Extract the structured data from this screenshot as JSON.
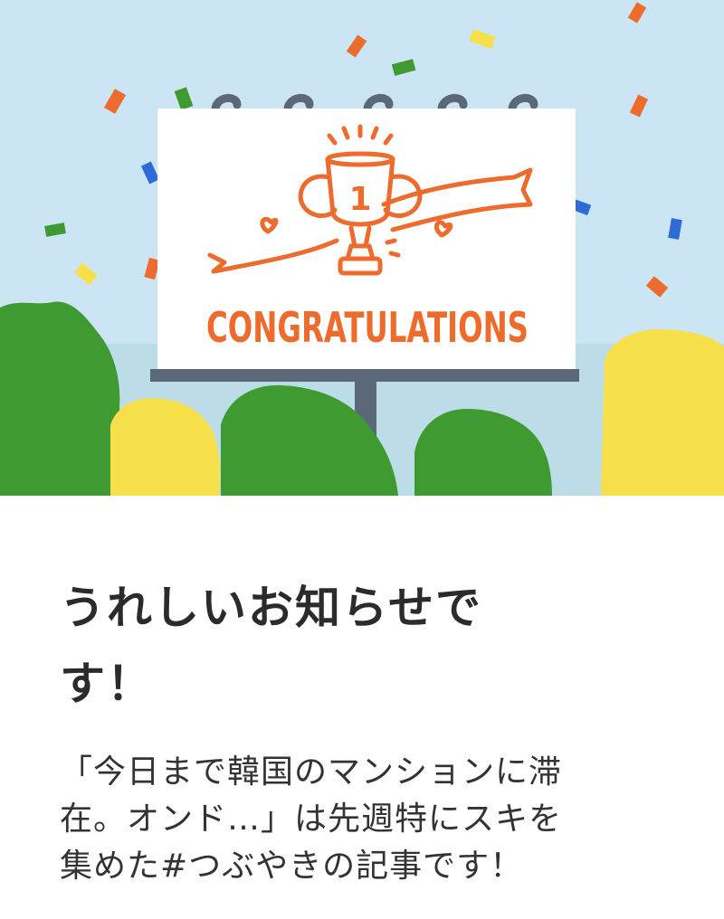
{
  "banner": {
    "sign_text": "CONGRATULATIONS",
    "trophy_number": "1",
    "colors": {
      "sky": "#cce5f5",
      "accent": "#ec6b2d",
      "tree_green": "#3f9a32",
      "tree_yellow": "#f7e04a",
      "pole": "#5b6878"
    }
  },
  "notice": {
    "title_lines": [
      "うれしいお知らせで",
      "す！"
    ],
    "body_lines": [
      "「今日まで韓国のマンションに滞",
      "在。オンド…」は先週特にスキを",
      "集めた#つぶやきの記事です！"
    ]
  }
}
